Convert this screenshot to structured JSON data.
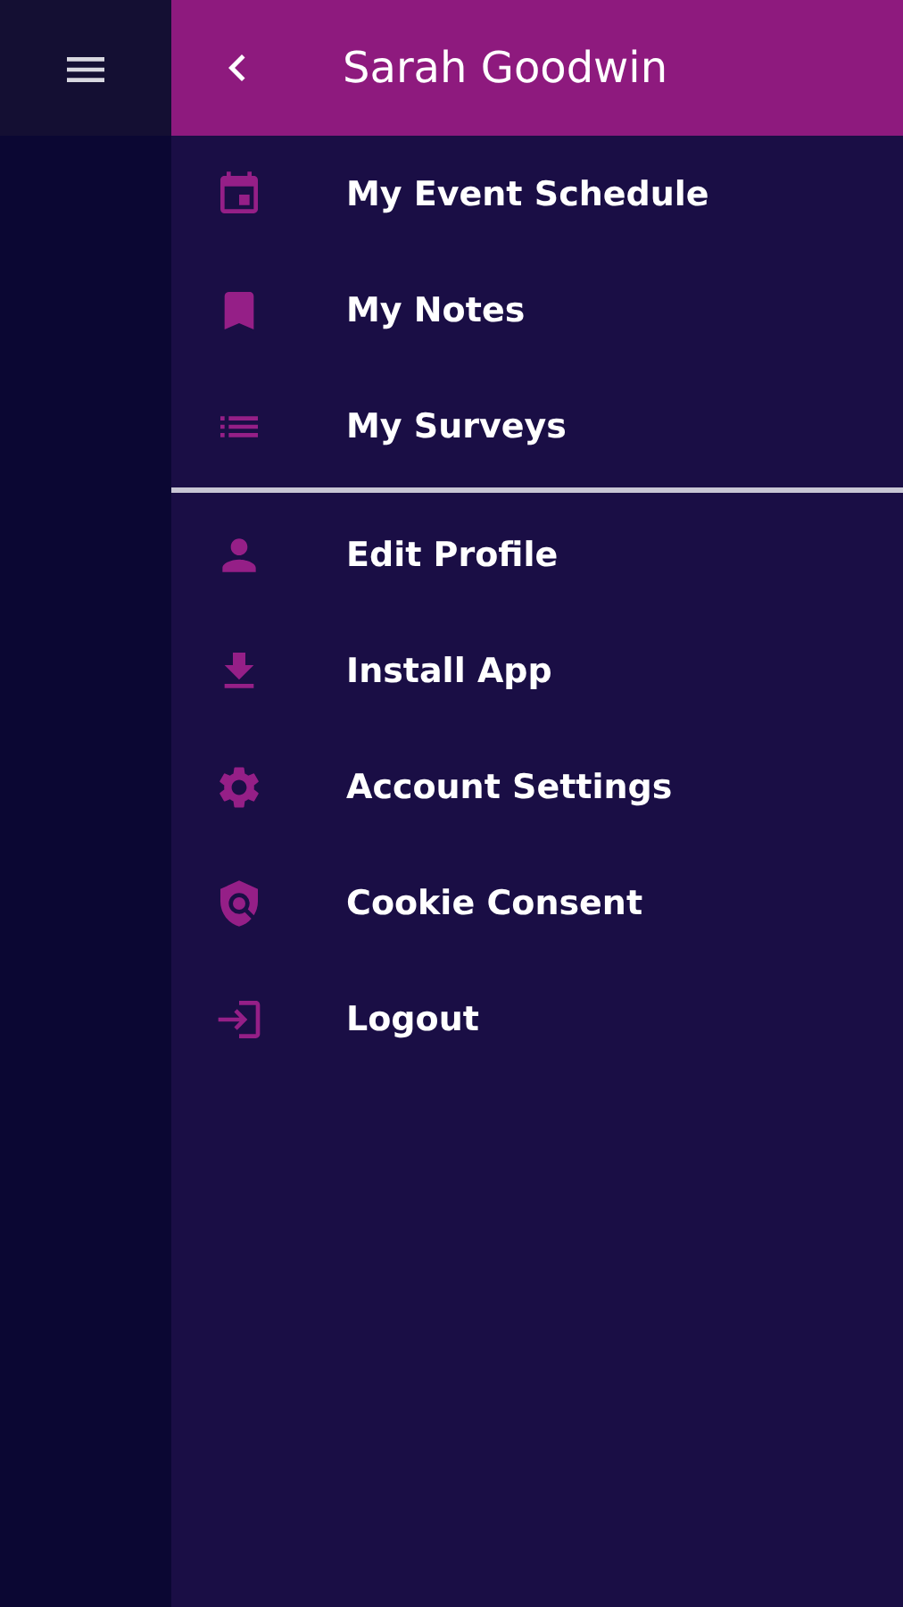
{
  "header": {
    "title": "Sarah Goodwin"
  },
  "sections": [
    {
      "items": [
        {
          "label": "My Event Schedule"
        },
        {
          "label": "My Notes"
        },
        {
          "label": "My Surveys"
        }
      ]
    },
    {
      "items": [
        {
          "label": "Edit Profile"
        },
        {
          "label": "Install App"
        },
        {
          "label": "Account Settings"
        },
        {
          "label": "Cookie Consent"
        },
        {
          "label": "Logout"
        }
      ]
    }
  ]
}
